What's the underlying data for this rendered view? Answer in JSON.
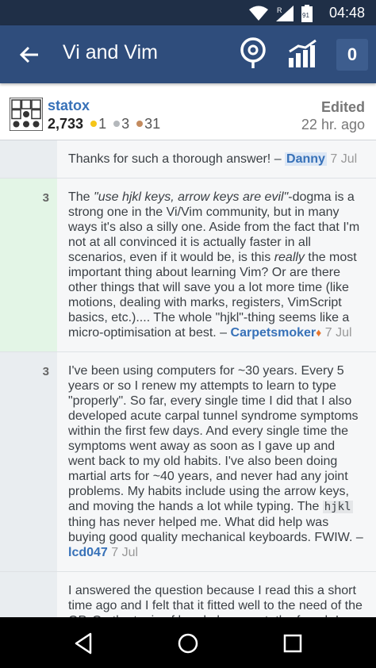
{
  "status_bar": {
    "time": "04:48",
    "battery": "91",
    "signal_badge": "R"
  },
  "app_bar": {
    "title": "Vi and Vim",
    "inbox_count": "0"
  },
  "post_owner": {
    "name": "statox",
    "reputation": "2,733",
    "gold": "1",
    "silver": "3",
    "bronze": "31",
    "edited_label": "Edited",
    "edited_time": "22 hr. ago",
    "badge_colors": {
      "gold": "#f5c518",
      "silver": "#b4b8bc",
      "bronze": "#c38b5f"
    }
  },
  "comments": [
    {
      "score": "",
      "text": "Thanks for such a thorough answer! – ",
      "author": "Danny",
      "date": "7 Jul"
    },
    {
      "score": "3",
      "text_a": "The ",
      "text_em": "\"use hjkl keys, arrow keys are evil\"",
      "text_b": "-dogma is a strong one in the Vi/Vim community, but in many ways it's also a silly one. Aside from the fact that I'm not at all convinced it is actually faster in all scenarios, even if it would be, is this ",
      "text_em2": "really",
      "text_c": " the most important thing about learning Vim? Or are there other things that will save you a lot more time (like motions, dealing with marks, registers, VimScript basics, etc.).... The whole \"hjkl\"-thing seems like a micro-optimisation at best. – ",
      "author": "Carpetsmoker",
      "date": "7 Jul"
    },
    {
      "score": "3",
      "text_a": "I've been using computers for ~30 years. Every 5 years or so I renew my attempts to learn to type \"properly\". So far, every single time I did that I also developed acute carpal tunnel syndrome symptoms within the first few days. And every single time the symptoms went away as soon as I gave up and went back to my old habits. I've also been doing martial arts for ~40 years, and never had any joint problems. My habits include using the arrow keys, and moving the hands a lot while typing. The ",
      "code": "hjkl",
      "text_b": " thing has never helped me. What did help was buying good quality mechanical keyboards. FWIW. – ",
      "author": "lcd047",
      "date": "7 Jul"
    },
    {
      "score": "",
      "text": "I answered the question because I read this a short time ago and I felt that it fitted well to the need of the OP. On the topic of hand placement, the french I am uses an AZERTY keyboard so the question doesn't"
    }
  ]
}
